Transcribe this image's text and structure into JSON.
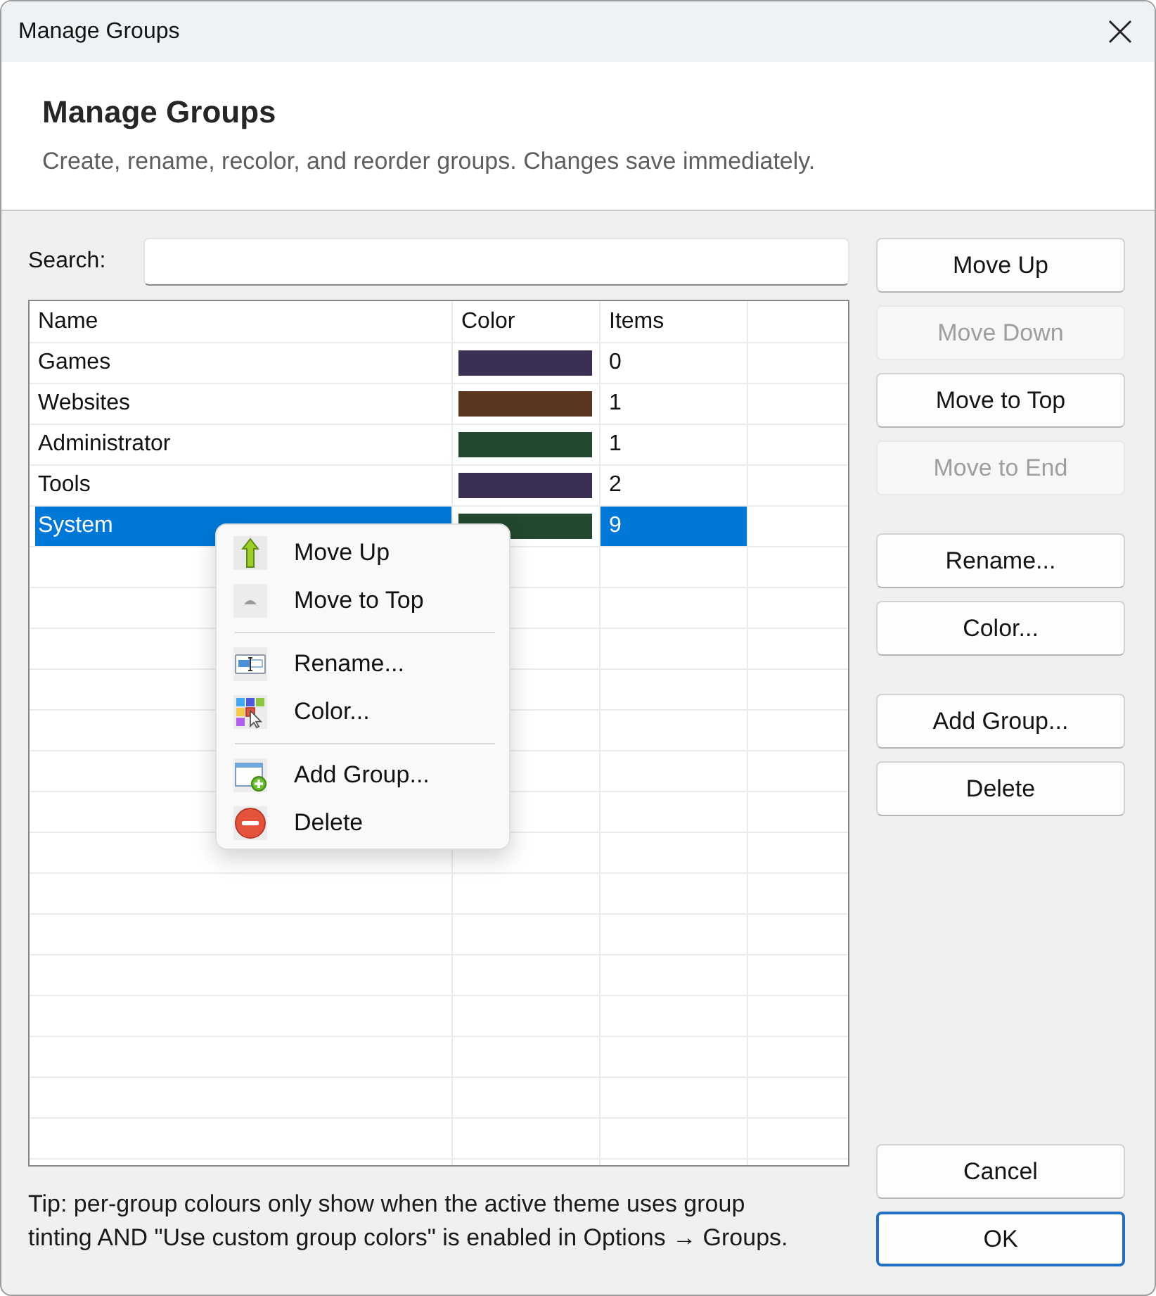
{
  "window": {
    "title": "Manage Groups"
  },
  "header": {
    "title": "Manage Groups",
    "subtitle": "Create, rename, recolor, and reorder groups. Changes save immediately."
  },
  "search": {
    "label": "Search:"
  },
  "table": {
    "columns": [
      "Name",
      "Color",
      "Items"
    ],
    "rows": [
      {
        "name": "Games",
        "color": "#3b2f54",
        "items": "0",
        "selected": false
      },
      {
        "name": "Websites",
        "color": "#5b3720",
        "items": "1",
        "selected": false
      },
      {
        "name": "Administrator",
        "color": "#23472f",
        "items": "1",
        "selected": false
      },
      {
        "name": "Tools",
        "color": "#3b2f54",
        "items": "2",
        "selected": false
      },
      {
        "name": "System",
        "color": "#23472f",
        "items": "9",
        "selected": true
      }
    ]
  },
  "context_menu": {
    "sections": [
      [
        {
          "label": "Move Up"
        },
        {
          "label": "Move to Top"
        }
      ],
      [
        {
          "label": "Rename..."
        },
        {
          "label": "Color..."
        }
      ],
      [
        {
          "label": "Add Group..."
        },
        {
          "label": "Delete"
        }
      ]
    ]
  },
  "side_buttons": [
    [
      {
        "label": "Move Up",
        "disabled": false
      },
      {
        "label": "Move Down",
        "disabled": true
      },
      {
        "label": "Move to Top",
        "disabled": false
      },
      {
        "label": "Move to End",
        "disabled": true
      }
    ],
    [
      {
        "label": "Rename...",
        "disabled": false
      },
      {
        "label": "Color...",
        "disabled": false
      }
    ],
    [
      {
        "label": "Add Group...",
        "disabled": false
      },
      {
        "label": "Delete",
        "disabled": false
      }
    ]
  ],
  "dialog_buttons": [
    {
      "label": "Cancel",
      "default": false
    },
    {
      "label": "OK",
      "default": true
    }
  ],
  "tip": "Tip: per-group colours only show when the active theme uses group tinting AND \"Use custom group colors\" is enabled in Options → Groups."
}
